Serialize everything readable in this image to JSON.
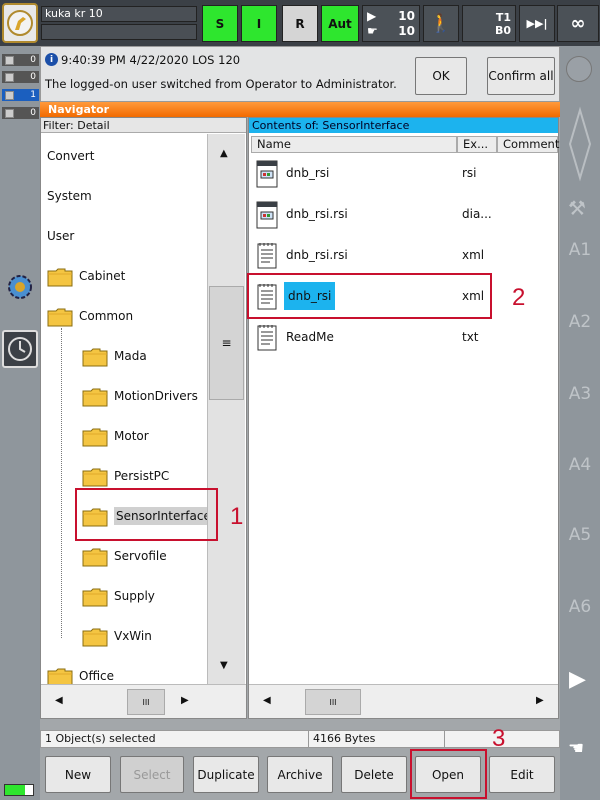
{
  "top": {
    "robot_name": "kuka kr 10",
    "status_s": "S",
    "status_i": "I",
    "status_r": "R",
    "mode": "Aut",
    "override_prog": "10",
    "override_jog": "10",
    "tool": "T1",
    "base": "B0",
    "increment": "∞"
  },
  "left_counters": [
    {
      "icon": "error-counter-icon",
      "value": "0"
    },
    {
      "icon": "warning-counter-icon",
      "value": "0"
    },
    {
      "icon": "info-counter-icon",
      "value": "1"
    },
    {
      "icon": "wait-counter-icon",
      "value": "0"
    }
  ],
  "message": {
    "time": "9:40:39 PM 4/22/2020 LOS 120",
    "text": "The logged-on user switched from Operator to Administrator.",
    "ok_label": "OK",
    "confirm_all_label": "Confirm all"
  },
  "navigator": {
    "title": "Navigator",
    "filter": "Filter: Detail",
    "contents_label": "Contents of: SensorInterface",
    "tree": [
      {
        "label": "Convert",
        "folder": false
      },
      {
        "label": "System",
        "folder": false
      },
      {
        "label": "User",
        "folder": false
      },
      {
        "label": "Cabinet",
        "folder": true,
        "level": 0
      },
      {
        "label": "Common",
        "folder": true,
        "level": 0
      },
      {
        "label": "Mada",
        "folder": true,
        "level": 1
      },
      {
        "label": "MotionDrivers",
        "folder": true,
        "level": 1
      },
      {
        "label": "Motor",
        "folder": true,
        "level": 1
      },
      {
        "label": "PersistPC",
        "folder": true,
        "level": 1
      },
      {
        "label": "SensorInterface",
        "folder": true,
        "level": 1,
        "selected": true
      },
      {
        "label": "Servofile",
        "folder": true,
        "level": 1
      },
      {
        "label": "Supply",
        "folder": true,
        "level": 1
      },
      {
        "label": "VxWin",
        "folder": true,
        "level": 1
      },
      {
        "label": "Office",
        "folder": true,
        "level": 0
      }
    ],
    "columns": [
      "Name",
      "Ex...",
      "Comment"
    ],
    "files": [
      {
        "name": "dnb_rsi",
        "ext": "rsi",
        "icon": "rsi-file-icon"
      },
      {
        "name": "dnb_rsi.rsi",
        "ext": "dia...",
        "icon": "rsi-file-icon"
      },
      {
        "name": "dnb_rsi.rsi",
        "ext": "xml",
        "icon": "xml-file-icon"
      },
      {
        "name": "dnb_rsi",
        "ext": "xml",
        "icon": "xml-file-icon",
        "selected": true
      },
      {
        "name": "ReadMe",
        "ext": "txt",
        "icon": "text-file-icon"
      }
    ],
    "scroll_grip": "≡",
    "hgrip": "III"
  },
  "status": {
    "selected": "1 Object(s) selected",
    "size": "4166 Bytes"
  },
  "buttons": [
    "New",
    "Select",
    "Duplicate",
    "Archive",
    "Delete",
    "Open",
    "Edit"
  ],
  "annotations": [
    "1",
    "2",
    "3"
  ],
  "axes": [
    "A1",
    "A2",
    "A3",
    "A4",
    "A5",
    "A6"
  ],
  "colors": {
    "accent_orange": "#f26a00",
    "selection_blue": "#1cb3ee",
    "status_green": "#2ee62e",
    "annotation_red": "#c8102e"
  }
}
